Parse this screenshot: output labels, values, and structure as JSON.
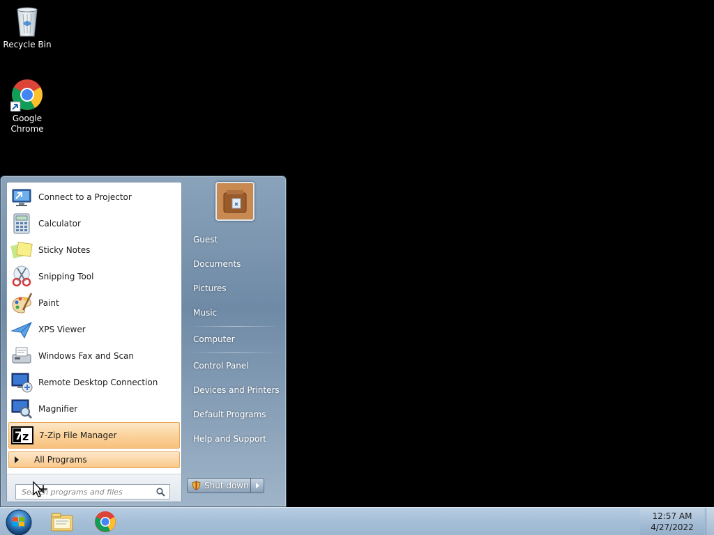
{
  "desktop": {
    "icons": [
      {
        "label": "Recycle Bin",
        "icon": "recycle-bin-icon"
      },
      {
        "label": "Google Chrome",
        "icon": "chrome-icon"
      }
    ]
  },
  "start_menu": {
    "programs": [
      {
        "label": "Connect to a Projector",
        "icon": "projector-icon"
      },
      {
        "label": "Calculator",
        "icon": "calculator-icon"
      },
      {
        "label": "Sticky Notes",
        "icon": "sticky-notes-icon"
      },
      {
        "label": "Snipping Tool",
        "icon": "snipping-tool-icon"
      },
      {
        "label": "Paint",
        "icon": "paint-icon"
      },
      {
        "label": "XPS Viewer",
        "icon": "xps-viewer-icon"
      },
      {
        "label": "Windows Fax and Scan",
        "icon": "fax-scan-icon"
      },
      {
        "label": "Remote Desktop Connection",
        "icon": "remote-desktop-icon"
      },
      {
        "label": "Magnifier",
        "icon": "magnifier-icon"
      },
      {
        "label": "7-Zip File Manager",
        "icon": "7zip-icon",
        "highlighted": true
      }
    ],
    "all_programs_label": "All Programs",
    "search_placeholder": "Search programs and files",
    "right_items": [
      {
        "label": "Guest"
      },
      {
        "label": "Documents"
      },
      {
        "label": "Pictures"
      },
      {
        "label": "Music"
      },
      {
        "label": "Computer"
      },
      {
        "label": "Control Panel"
      },
      {
        "label": "Devices and Printers"
      },
      {
        "label": "Default Programs"
      },
      {
        "label": "Help and Support"
      }
    ],
    "shutdown_label": "Shut down",
    "accent_highlight": "#f9c88a"
  },
  "taskbar": {
    "items": [
      {
        "name": "start-orb-icon"
      },
      {
        "name": "windows-explorer-icon"
      },
      {
        "name": "chrome-icon"
      }
    ],
    "clock": {
      "time": "12:57 AM",
      "date": "4/27/2022"
    }
  }
}
